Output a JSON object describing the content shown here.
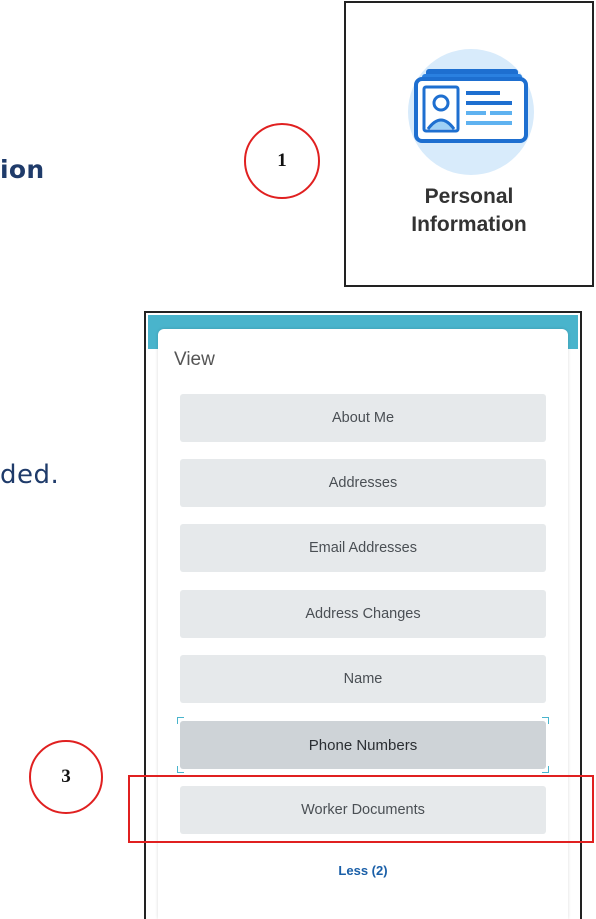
{
  "instructions": {
    "line1_partial": "ion",
    "line2_partial": "ded."
  },
  "callouts": {
    "step1": "1",
    "step3": "3"
  },
  "worklet": {
    "label_line1": "Personal",
    "label_line2": "Information",
    "icon": "id-card-icon"
  },
  "view_panel": {
    "title": "View",
    "buttons": [
      "About Me",
      "Addresses",
      "Email Addresses",
      "Address Changes",
      "Name",
      "Phone Numbers",
      "Worker Documents"
    ],
    "less_link": "Less (2)"
  },
  "colors": {
    "accent_bar": "#49b4cc",
    "callout_red": "#e02020",
    "instruction_text": "#1f3b6a",
    "link_blue": "#1a5fa8"
  }
}
